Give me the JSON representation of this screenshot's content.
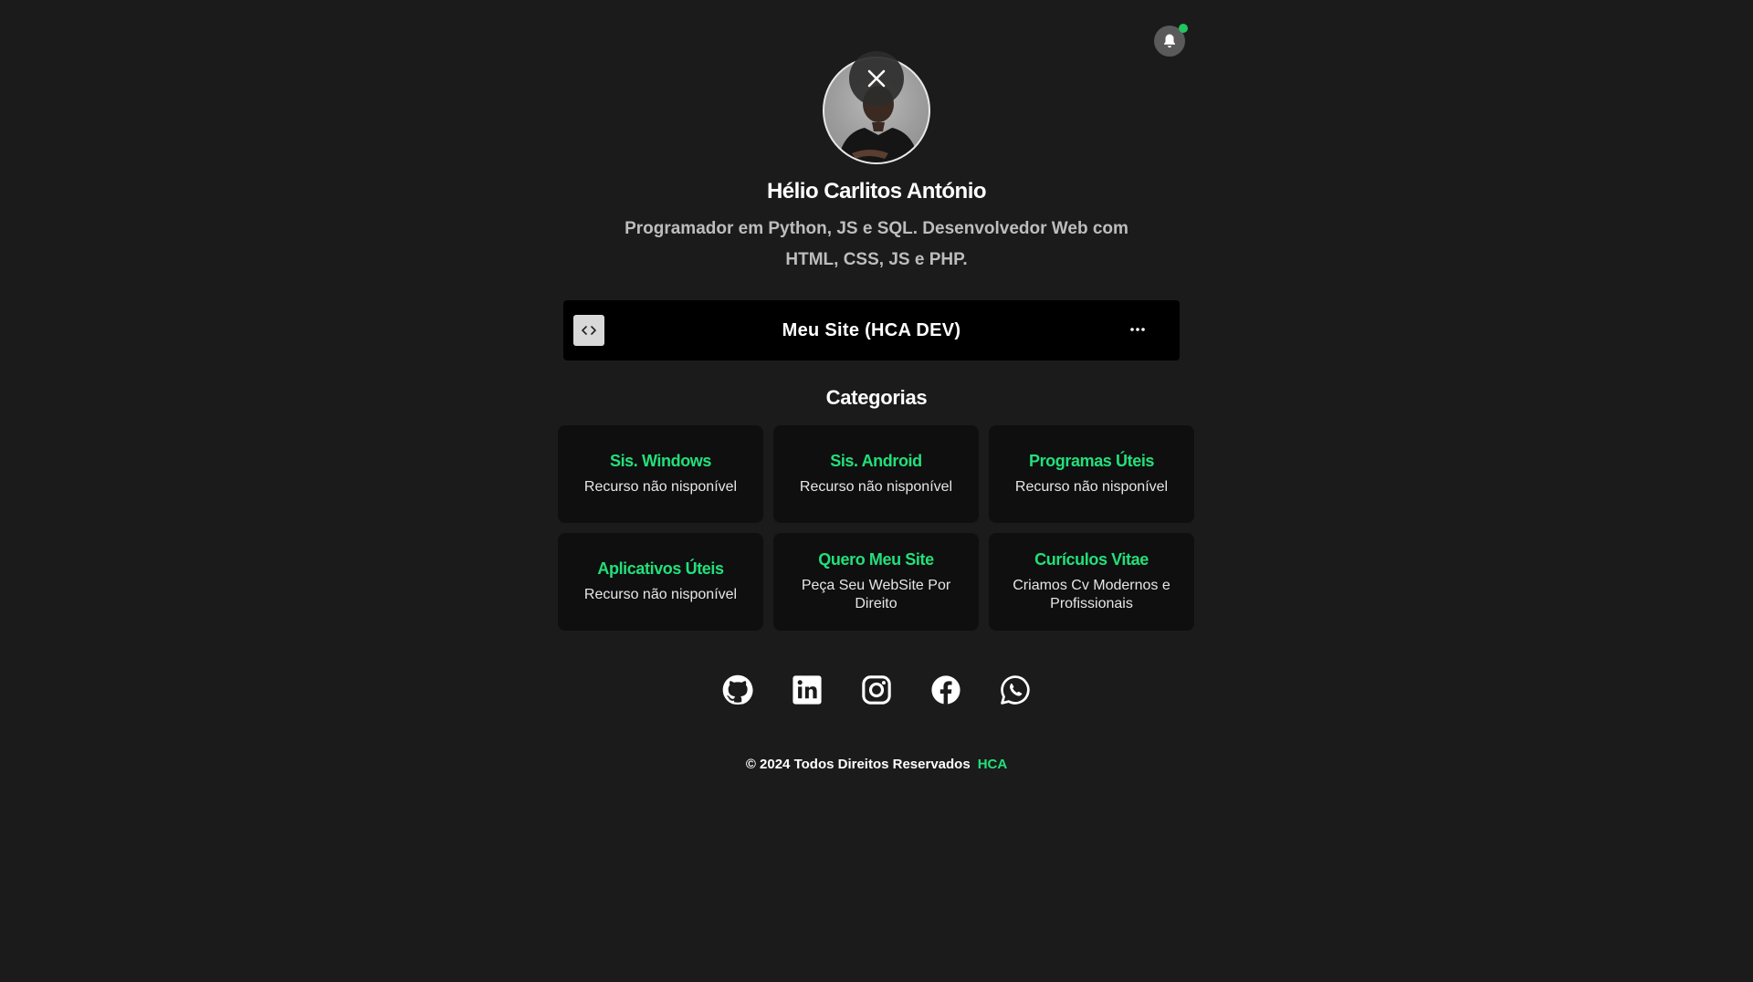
{
  "profile": {
    "name": "Hélio Carlitos António",
    "bio": "Programador em Python, JS e SQL. Desenvolvedor Web com HTML, CSS, JS e PHP."
  },
  "site_link": {
    "label": "Meu Site (HCA DEV)",
    "icon": "code-icon",
    "more_icon": "ellipsis-icon"
  },
  "categories": {
    "title": "Categorias",
    "items": [
      {
        "title": "Sis. Windows",
        "desc": "Recurso não nisponível"
      },
      {
        "title": "Sis. Android",
        "desc": "Recurso não nisponível"
      },
      {
        "title": "Programas Úteis",
        "desc": "Recurso não nisponível"
      },
      {
        "title": "Aplicativos Úteis",
        "desc": "Recurso não nisponível"
      },
      {
        "title": "Quero Meu Site",
        "desc": "Peça Seu WebSite Por Direito"
      },
      {
        "title": "Curículos Vitae",
        "desc": "Criamos Cv Modernos e Profissionais"
      }
    ]
  },
  "socials": [
    "github-icon",
    "linkedin-icon",
    "instagram-icon",
    "facebook-icon",
    "whatsapp-icon"
  ],
  "footer": {
    "text": "© 2024 Todos Direitos Reservados",
    "brand": "HCA"
  },
  "colors": {
    "background": "#1b1b1b",
    "accent": "#22e07a",
    "card": "#0f0f0f",
    "notification_dot": "#22c55e"
  }
}
